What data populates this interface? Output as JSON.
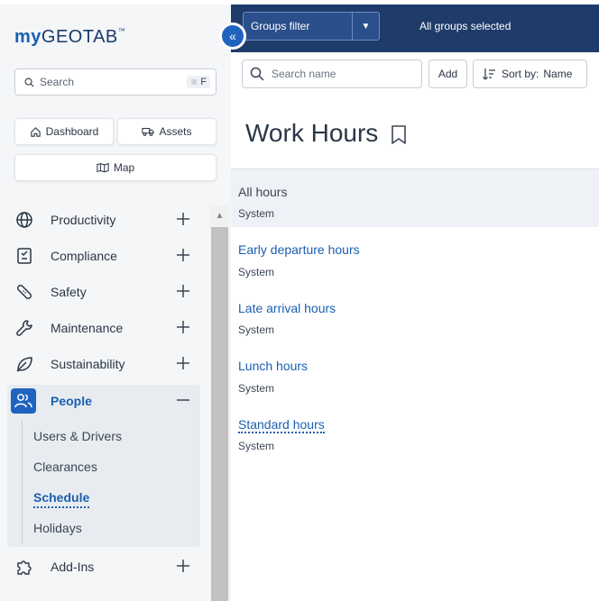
{
  "app": {
    "logo_my": "my",
    "logo_geotab": "GEOTAB",
    "logo_tm": "™"
  },
  "sidebar": {
    "search_label": "Search",
    "search_shortcut": "F",
    "quick_buttons": {
      "dashboard": "Dashboard",
      "assets": "Assets",
      "map": "Map"
    },
    "nav": [
      {
        "label": "Productivity",
        "icon": "globe-icon"
      },
      {
        "label": "Compliance",
        "icon": "clipboard-icon"
      },
      {
        "label": "Safety",
        "icon": "bandage-icon"
      },
      {
        "label": "Maintenance",
        "icon": "wrench-icon"
      },
      {
        "label": "Sustainability",
        "icon": "leaf-icon"
      }
    ],
    "people": {
      "label": "People",
      "sub_items": [
        "Users & Drivers",
        "Clearances",
        "Schedule",
        "Holidays"
      ],
      "active_sub": "Schedule"
    },
    "addins": {
      "label": "Add-Ins",
      "icon": "puzzle-icon"
    }
  },
  "topbar": {
    "groups_filter": "Groups filter",
    "groups_selected": "All groups selected"
  },
  "toolbar": {
    "search_placeholder": "Search name",
    "add_label": "Add",
    "sort_label": "Sort by:",
    "sort_value": "Name"
  },
  "main": {
    "title": "Work Hours",
    "items": [
      {
        "name": "All hours",
        "sub": "System",
        "selected": true
      },
      {
        "name": "Early departure hours",
        "sub": "System"
      },
      {
        "name": "Late arrival hours",
        "sub": "System"
      },
      {
        "name": "Lunch hours",
        "sub": "System"
      },
      {
        "name": "Standard hours",
        "sub": "System"
      }
    ]
  },
  "colors": {
    "accent": "#1f63bf",
    "topbar": "#1f3b6a",
    "link": "#1b5fb0"
  }
}
